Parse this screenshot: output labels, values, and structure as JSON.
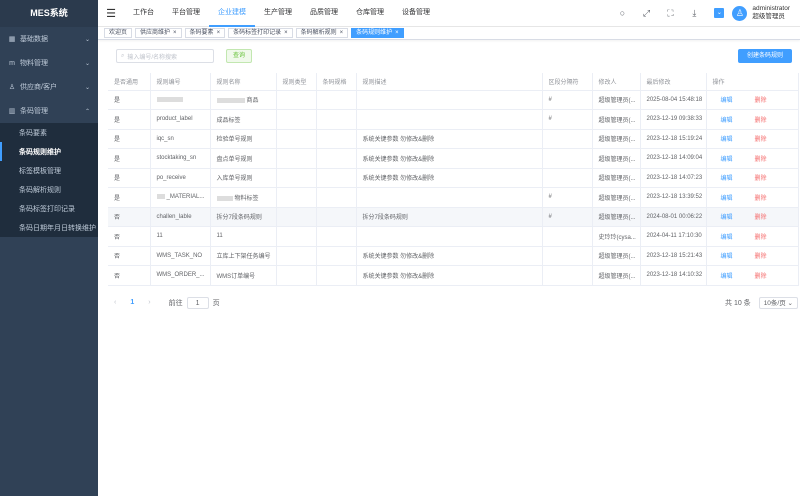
{
  "app": {
    "title": "MES系统"
  },
  "sidebar": {
    "groups": [
      {
        "label": "基础数据",
        "icon": "grid-icon"
      },
      {
        "label": "物料管理",
        "icon": "m-icon"
      },
      {
        "label": "供应商/客户",
        "icon": "user-icon"
      },
      {
        "label": "条码管理",
        "icon": "barcode-icon"
      }
    ],
    "items": [
      "条码要素",
      "条码规则维护",
      "标签模板管理",
      "条码解析规则",
      "条码标签打印记录",
      "条码日期年月日转换维护"
    ]
  },
  "topnav": [
    "工作台",
    "平台管理",
    "企业建模",
    "生产管理",
    "品质管理",
    "仓库管理",
    "设备管理"
  ],
  "user": {
    "name": "administrator",
    "role": "超级管理员"
  },
  "tabs": [
    "欢迎页",
    "供应商维护",
    "条码要素",
    "条码标签打印记录",
    "条码解析规则",
    "条码规则维护"
  ],
  "search": {
    "placeholder": "输入编号/名称搜索",
    "query_label": "查询",
    "create_label": "创建条码规则"
  },
  "table": {
    "headers": [
      "是否通用",
      "规则编号",
      "规则名称",
      "规则类型",
      "条码规格",
      "规则描述",
      "区段分隔符",
      "修改人",
      "最后修改",
      "操作"
    ],
    "edit_label": "编辑",
    "delete_label": "删除",
    "rows": [
      {
        "general": "是",
        "code": "",
        "name": "商品",
        "type": "",
        "spec": "",
        "desc": "",
        "sep": "#",
        "modifier": "超级管理员(...",
        "modified": "2025-08-04 15:48:18"
      },
      {
        "general": "是",
        "code": "product_label",
        "name": "成品标签",
        "type": "",
        "spec": "",
        "desc": "",
        "sep": "#",
        "modifier": "超级管理员(...",
        "modified": "2023-12-19 09:38:33"
      },
      {
        "general": "是",
        "code": "iqc_sn",
        "name": "检验单号规则",
        "type": "",
        "spec": "",
        "desc": "系统关键参数 勿修改&删除",
        "sep": "",
        "modifier": "超级管理员(...",
        "modified": "2023-12-18 15:19:24"
      },
      {
        "general": "是",
        "code": "stocktaking_sn",
        "name": "盘点单号规则",
        "type": "",
        "spec": "",
        "desc": "系统关键参数 勿修改&删除",
        "sep": "",
        "modifier": "超级管理员(...",
        "modified": "2023-12-18 14:09:04"
      },
      {
        "general": "是",
        "code": "po_receive",
        "name": "入库单号规则",
        "type": "",
        "spec": "",
        "desc": "系统关键参数 勿修改&删除",
        "sep": "",
        "modifier": "超级管理员(...",
        "modified": "2023-12-18 14:07:23"
      },
      {
        "general": "是",
        "code": "_MATERIAL...",
        "name": "物料标签",
        "type": "",
        "spec": "",
        "desc": "",
        "sep": "#",
        "modifier": "超级管理员(...",
        "modified": "2023-12-18 13:39:52"
      },
      {
        "general": "否",
        "code": "challen_lable",
        "name": "拆分7段条码规则",
        "type": "",
        "spec": "",
        "desc": "拆分7段条码规则",
        "sep": "#",
        "modifier": "超级管理员(...",
        "modified": "2024-08-01 00:06:22"
      },
      {
        "general": "否",
        "code": "11",
        "name": "11",
        "type": "",
        "spec": "",
        "desc": "",
        "sep": "",
        "modifier": "史玲玲(cysa...",
        "modified": "2024-04-11 17:10:30"
      },
      {
        "general": "否",
        "code": "WMS_TASK_NO",
        "name": "立库上下架任务编号",
        "type": "",
        "spec": "",
        "desc": "系统关键参数 勿修改&删除",
        "sep": "",
        "modifier": "超级管理员(...",
        "modified": "2023-12-18 15:21:43"
      },
      {
        "general": "否",
        "code": "WMS_ORDER_...",
        "name": "WMS订单编号",
        "type": "",
        "spec": "",
        "desc": "系统关键参数 勿修改&删除",
        "sep": "",
        "modifier": "超级管理员(...",
        "modified": "2023-12-18 14:10:32"
      }
    ]
  },
  "pager": {
    "current": "1",
    "goto_label": "前往",
    "page_suffix": "页",
    "total": "共 10 条",
    "size": "10条/页"
  }
}
